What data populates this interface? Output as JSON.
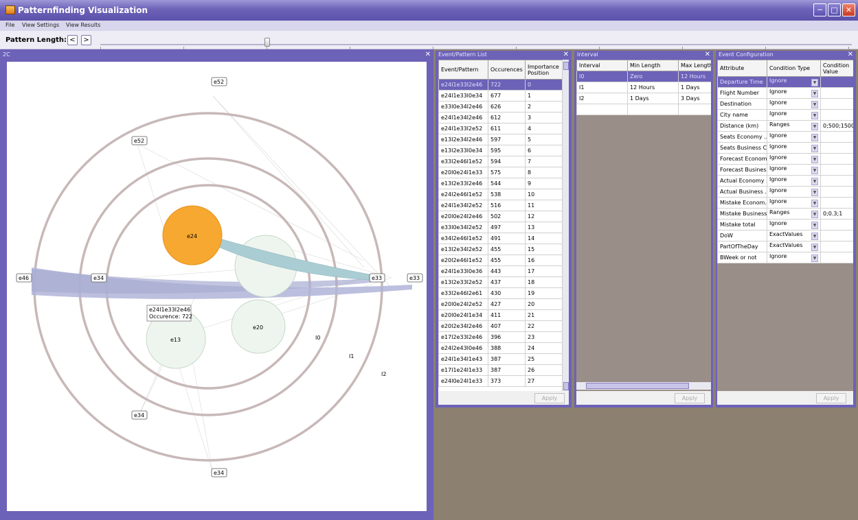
{
  "window": {
    "title": "Patternfinding Visualization"
  },
  "menu": {
    "file": "File",
    "view_settings": "View Settings",
    "view_results": "View Results"
  },
  "toolbar": {
    "pattern_length_label": "Pattern Length: 2",
    "prev": "<",
    "next": ">"
  },
  "vis_panel": {
    "title": "2C",
    "rings": [
      "I0",
      "I1",
      "I2"
    ],
    "nodes": {
      "e52_top": "e52",
      "e52_mid": "e52",
      "e46": "e46",
      "e34_left": "e34",
      "e33_inner": "e33",
      "e33_outer": "e33",
      "e34_bottom1": "e34",
      "e34_bottom2": "e34"
    },
    "bubbles": {
      "e24": "e24",
      "e20": "e20",
      "e13": "e13"
    },
    "tooltip": {
      "line1": "e24I1e33I2e46",
      "line2": "Occurence: 722"
    },
    "colors": {
      "selected": "#f7a830",
      "flow": "#aacdd4",
      "band": "#b0b4d8"
    }
  },
  "event_panel": {
    "title": "Event/Pattern List",
    "headers": [
      "Event/Pattern",
      "Occurences",
      "Importance Position"
    ],
    "rows": [
      [
        "e24I1e33I2e46",
        "722",
        "0"
      ],
      [
        "e24I1e33I0e34",
        "677",
        "1"
      ],
      [
        "e33I0e34I2e46",
        "626",
        "2"
      ],
      [
        "e24I1e34I2e46",
        "612",
        "3"
      ],
      [
        "e24I1e33I2e52",
        "611",
        "4"
      ],
      [
        "e13I2e34I2e46",
        "597",
        "5"
      ],
      [
        "e13I2e33I0e34",
        "595",
        "6"
      ],
      [
        "e33I2e46I1e52",
        "594",
        "7"
      ],
      [
        "e20I0e24I1e33",
        "575",
        "8"
      ],
      [
        "e13I2e33I2e46",
        "544",
        "9"
      ],
      [
        "e24I2e46I1e52",
        "538",
        "10"
      ],
      [
        "e24I1e34I2e52",
        "516",
        "11"
      ],
      [
        "e20I0e24I2e46",
        "502",
        "12"
      ],
      [
        "e33I0e34I2e52",
        "497",
        "13"
      ],
      [
        "e34I2e46I1e52",
        "491",
        "14"
      ],
      [
        "e13I2e34I2e52",
        "455",
        "15"
      ],
      [
        "e20I2e46I1e52",
        "455",
        "16"
      ],
      [
        "e24I1e33I0e36",
        "443",
        "17"
      ],
      [
        "e13I2e33I2e52",
        "437",
        "18"
      ],
      [
        "e33I2e46I2e61",
        "430",
        "19"
      ],
      [
        "e20I0e24I2e52",
        "427",
        "20"
      ],
      [
        "e20I0e24I1e34",
        "411",
        "21"
      ],
      [
        "e20I2e34I2e46",
        "407",
        "22"
      ],
      [
        "e17I2e33I2e46",
        "396",
        "23"
      ],
      [
        "e24I2e43I0e46",
        "388",
        "24"
      ],
      [
        "e24I1e34I1e43",
        "387",
        "25"
      ],
      [
        "e17I1e24I1e33",
        "387",
        "26"
      ],
      [
        "e24I0e24I1e33",
        "373",
        "27"
      ]
    ],
    "apply": "Apply"
  },
  "interval_panel": {
    "title": "Interval",
    "headers": [
      "Interval",
      "Min Length",
      "Max Length"
    ],
    "rows": [
      [
        "I0",
        "Zero",
        "12 Hours"
      ],
      [
        "I1",
        "12 Hours",
        "1 Days"
      ],
      [
        "I2",
        "1 Days",
        "3 Days"
      ]
    ],
    "apply": "Apply"
  },
  "config_panel": {
    "title": "Event Configuration",
    "headers": [
      "Attribute",
      "Condition Type",
      "Condition Value"
    ],
    "rows": [
      [
        "Departure Time",
        "Ignore",
        ""
      ],
      [
        "Flight Number",
        "Ignore",
        ""
      ],
      [
        "Destination",
        "Ignore",
        ""
      ],
      [
        "City name",
        "Ignore",
        ""
      ],
      [
        "Distance (km)",
        "Ranges",
        "0;500;1500"
      ],
      [
        "Seats Economy ...",
        "Ignore",
        ""
      ],
      [
        "Seats Business C...",
        "Ignore",
        ""
      ],
      [
        "Forecast Econom...",
        "Ignore",
        ""
      ],
      [
        "Forecast Busines...",
        "Ignore",
        ""
      ],
      [
        "Actual Economy ...",
        "Ignore",
        ""
      ],
      [
        "Actual Business ...",
        "Ignore",
        ""
      ],
      [
        "Mistake Econom...",
        "Ignore",
        ""
      ],
      [
        "Mistake Business...",
        "Ranges",
        "0;0.3;1"
      ],
      [
        "Mistake total",
        "Ignore",
        ""
      ],
      [
        "DoW",
        "ExactValues",
        ""
      ],
      [
        "PartOfTheDay",
        "ExactValues",
        ""
      ],
      [
        "BWeek or not",
        "Ignore",
        ""
      ]
    ],
    "apply": "Apply"
  }
}
